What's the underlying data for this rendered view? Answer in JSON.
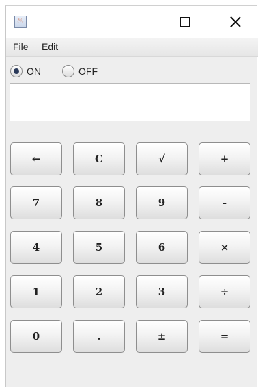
{
  "window": {
    "app_icon": "java-coffee-icon",
    "controls": {
      "minimize_icon": "minimize-icon",
      "maximize_icon": "maximize-icon",
      "close_icon": "close-icon"
    }
  },
  "menubar": {
    "items": [
      {
        "label": "File"
      },
      {
        "label": "Edit"
      }
    ]
  },
  "power": {
    "on_label": "ON",
    "off_label": "OFF",
    "selected": "ON"
  },
  "display": {
    "value": ""
  },
  "keys": [
    {
      "label": "←",
      "name": "backspace"
    },
    {
      "label": "C",
      "name": "clear"
    },
    {
      "label": "√",
      "name": "sqrt"
    },
    {
      "label": "+",
      "name": "plus"
    },
    {
      "label": "7",
      "name": "7"
    },
    {
      "label": "8",
      "name": "8"
    },
    {
      "label": "9",
      "name": "9"
    },
    {
      "label": "-",
      "name": "minus"
    },
    {
      "label": "4",
      "name": "4"
    },
    {
      "label": "5",
      "name": "5"
    },
    {
      "label": "6",
      "name": "6"
    },
    {
      "label": "×",
      "name": "multiply"
    },
    {
      "label": "1",
      "name": "1"
    },
    {
      "label": "2",
      "name": "2"
    },
    {
      "label": "3",
      "name": "3"
    },
    {
      "label": "÷",
      "name": "divide"
    },
    {
      "label": "0",
      "name": "0"
    },
    {
      "label": ".",
      "name": "decimal"
    },
    {
      "label": "±",
      "name": "sign"
    },
    {
      "label": "=",
      "name": "equals"
    }
  ]
}
